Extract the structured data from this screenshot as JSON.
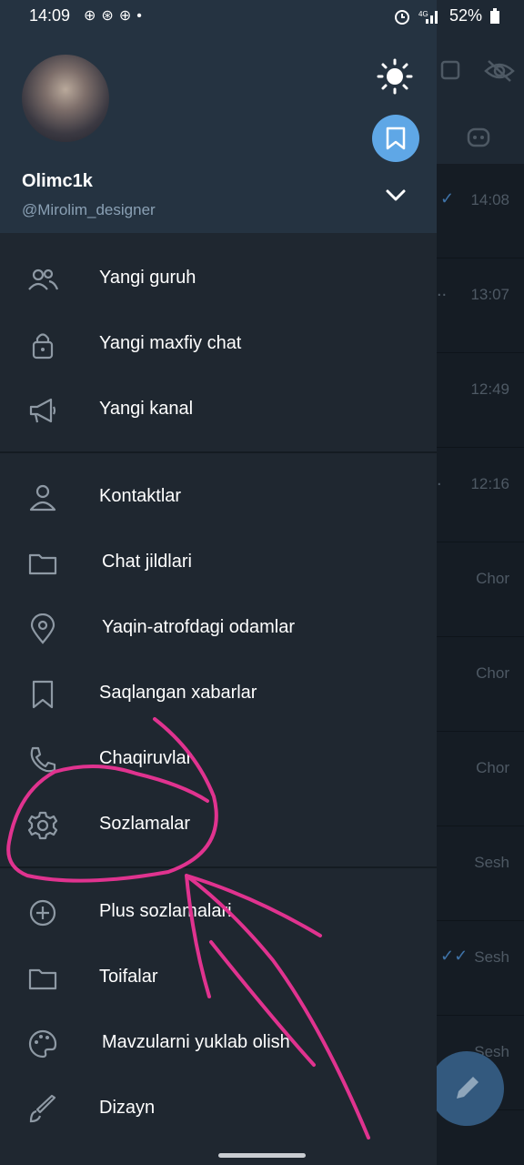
{
  "status_bar": {
    "time": "14:09",
    "battery": "52%"
  },
  "profile": {
    "name": "Olimc1k",
    "username": "@Mirolim_designer"
  },
  "menu": [
    {
      "label": "Yangi guruh"
    },
    {
      "label": "Yangi maxfiy chat"
    },
    {
      "label": "Yangi kanal"
    },
    {
      "label": "Kontaktlar"
    },
    {
      "label": "Chat jildlari"
    },
    {
      "label": "Yaqin-atrofdagi odamlar"
    },
    {
      "label": "Saqlangan xabarlar"
    },
    {
      "label": "Chaqiruvlar"
    },
    {
      "label": "Sozlamalar"
    },
    {
      "label": "Plus sozlamalari"
    },
    {
      "label": "Toifalar"
    },
    {
      "label": "Mavzularni yuklab olish"
    },
    {
      "label": "Dizayn"
    }
  ],
  "background_chats": [
    {
      "time": "14:08"
    },
    {
      "time": "13:07"
    },
    {
      "time": "12:49"
    },
    {
      "time": "12:16"
    },
    {
      "time": "Chor"
    },
    {
      "time": "Chor"
    },
    {
      "time": "Chor"
    },
    {
      "time": "Sesh"
    },
    {
      "time": "Sesh"
    },
    {
      "time": "Sesh"
    }
  ],
  "colors": {
    "drawer": "#1f2730",
    "header": "#253341",
    "accent": "#5fa7e6",
    "annotation": "#e0338f"
  }
}
